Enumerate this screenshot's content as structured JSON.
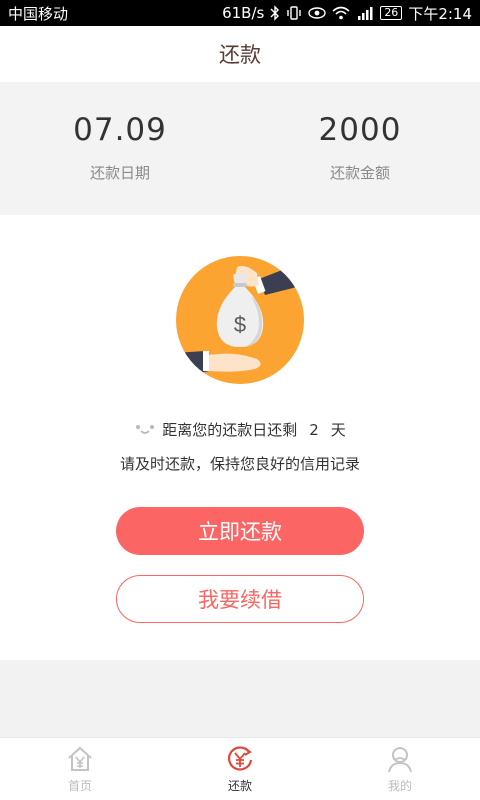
{
  "status_bar": {
    "carrier": "中国移动",
    "network_speed": "61B/s",
    "battery": "26",
    "time": "下午2:14"
  },
  "header": {
    "title": "还款"
  },
  "summary": {
    "date_value": "07.09",
    "date_label": "还款日期",
    "amount_value": "2000",
    "amount_label": "还款金额"
  },
  "main": {
    "illustration_icon": "money-bag-handover-icon",
    "countdown_prefix": "距离您的还款日还剩",
    "countdown_days": "2",
    "countdown_unit": "天",
    "tip": "请及时还款，保持您良好的信用记录",
    "repay_button": "立即还款",
    "renew_button": "我要续借"
  },
  "tabbar": {
    "items": [
      {
        "label": "首页",
        "icon": "home-yen-icon",
        "active": false
      },
      {
        "label": "还款",
        "icon": "repay-yen-icon",
        "active": true
      },
      {
        "label": "我的",
        "icon": "user-icon",
        "active": false
      }
    ]
  },
  "colors": {
    "accent": "#fb6665",
    "illustration_orange": "#fba432",
    "title_brown": "#5a3b35",
    "active_tab_icon": "#e2473d"
  }
}
